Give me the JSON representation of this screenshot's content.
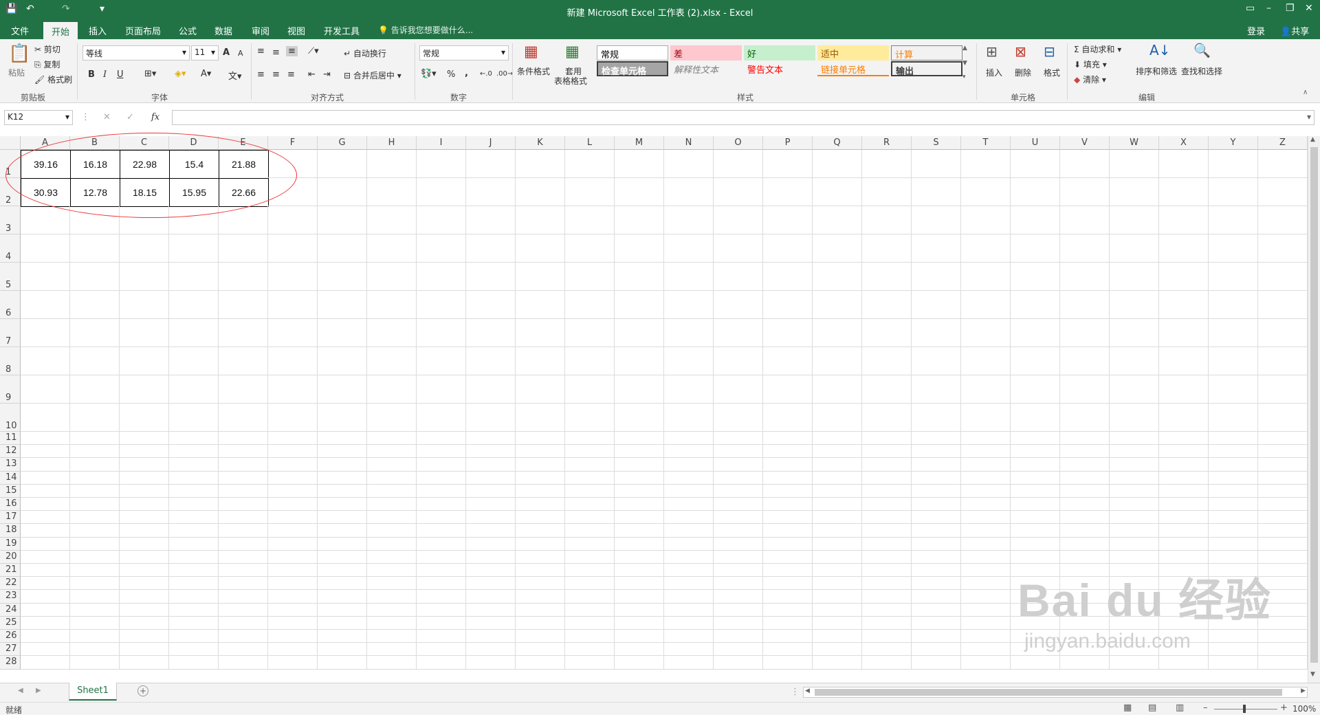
{
  "window": {
    "title": "新建 Microsoft Excel 工作表 (2).xlsx - Excel",
    "qa_save": "💾",
    "qa_undo": "↶",
    "qa_redo": "↷",
    "qa_more": "▾"
  },
  "tabs": [
    "文件",
    "开始",
    "插入",
    "页面布局",
    "公式",
    "数据",
    "审阅",
    "视图",
    "开发工具"
  ],
  "tell_me": "告诉我您想要做什么...",
  "account": {
    "login": "登录",
    "share": "共享"
  },
  "ribbon": {
    "clipboard": {
      "paste": "粘贴",
      "cut": "剪切",
      "copy": "复制",
      "format_painter": "格式刷",
      "label": "剪贴板"
    },
    "font": {
      "name": "等线",
      "size": "11",
      "bold": "B",
      "italic": "I",
      "underline": "U",
      "grow": "A",
      "shrink": "A",
      "color": "A",
      "label": "字体"
    },
    "alignment": {
      "wrap": "自动换行",
      "merge": "合并后居中",
      "label": "对齐方式"
    },
    "number": {
      "format": "常规",
      "percent": "%",
      "comma": ",",
      "label": "数字"
    },
    "styles": {
      "cond_format": "条件格式",
      "table_format_1": "套用",
      "table_format_2": "表格格式",
      "label": "样式",
      "cells": [
        {
          "text": "常规",
          "bg": "#ffffff",
          "fg": "#000000"
        },
        {
          "text": "差",
          "bg": "#ffc7ce",
          "fg": "#9c0006"
        },
        {
          "text": "好",
          "bg": "#c6efce",
          "fg": "#006100"
        },
        {
          "text": "适中",
          "bg": "#ffeb9c",
          "fg": "#9c5700"
        },
        {
          "text": "计算",
          "bg": "#f2f2f2",
          "fg": "#fa7d00"
        },
        {
          "text": "检查单元格",
          "bg": "#a5a5a5",
          "fg": "#ffffff"
        },
        {
          "text": "解释性文本",
          "bg": "#f3f3f3",
          "fg": "#7f7f7f"
        },
        {
          "text": "警告文本",
          "bg": "#f3f3f3",
          "fg": "#ff0000"
        },
        {
          "text": "链接单元格",
          "bg": "#f3f3f3",
          "fg": "#fa7d00"
        },
        {
          "text": "输出",
          "bg": "#f2f2f2",
          "fg": "#3f3f3f"
        }
      ]
    },
    "cells": {
      "insert": "插入",
      "delete": "删除",
      "format": "格式",
      "label": "单元格"
    },
    "editing": {
      "autosum": "自动求和",
      "fill": "填充",
      "clear": "清除",
      "sort": "排序和筛选",
      "find": "查找和选择",
      "label": "编辑"
    }
  },
  "formula_bar": {
    "name_box": "K12",
    "cancel": "✕",
    "enter": "✓",
    "fx": "fx",
    "value": ""
  },
  "columns": [
    "A",
    "B",
    "C",
    "D",
    "E",
    "F",
    "G",
    "H",
    "I",
    "J",
    "K",
    "L",
    "M",
    "N",
    "O",
    "P",
    "Q",
    "R",
    "S",
    "T",
    "U",
    "V",
    "W",
    "X",
    "Y",
    "Z"
  ],
  "rows": [
    "1",
    "2",
    "3",
    "4",
    "5",
    "6",
    "7",
    "8",
    "9",
    "10",
    "11",
    "12",
    "13",
    "14",
    "15",
    "16",
    "17",
    "18",
    "19",
    "20",
    "21",
    "22",
    "23",
    "24",
    "25",
    "26",
    "27",
    "28"
  ],
  "cell_data": [
    [
      "39.16",
      "16.18",
      "22.98",
      "15.4",
      "21.88"
    ],
    [
      "30.93",
      "12.78",
      "18.15",
      "15.95",
      "22.66"
    ]
  ],
  "sheet_tab": "Sheet1",
  "add_sheet": "+",
  "status": {
    "ready": "就绪",
    "zoom": "100%"
  },
  "watermark": {
    "brand": "Bai du 经验",
    "url": "jingyan.baidu.com"
  },
  "colors": {
    "excel_green": "#217346",
    "ellipse": "#e33333"
  }
}
